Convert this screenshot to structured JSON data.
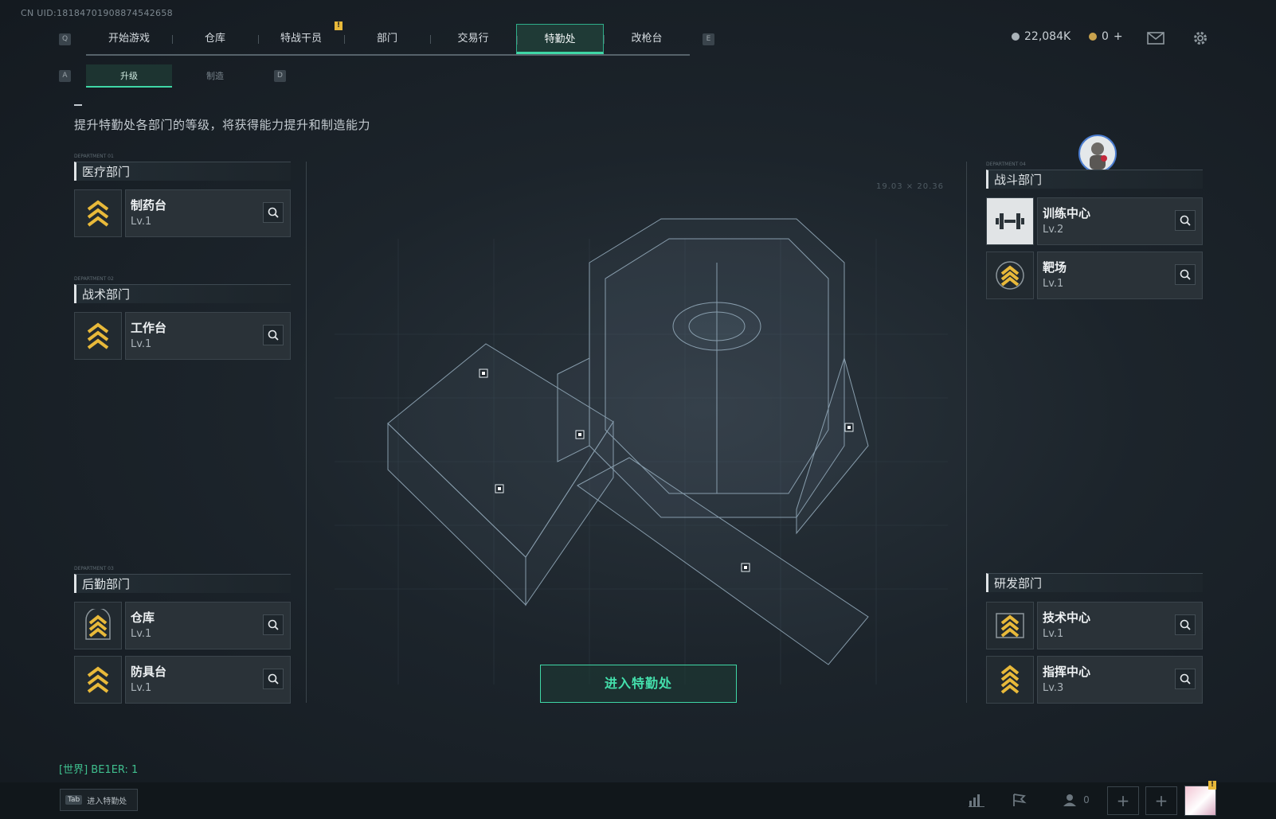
{
  "uid": "CN UID:18184701908874542658",
  "nav": {
    "left_key": "Q",
    "right_key": "E",
    "tabs": [
      {
        "label": "开始游戏"
      },
      {
        "label": "仓库"
      },
      {
        "label": "特战干员"
      },
      {
        "label": "部门"
      },
      {
        "label": "交易行"
      },
      {
        "label": "特勤处",
        "active": true
      },
      {
        "label": "改枪台"
      }
    ],
    "badge": "!"
  },
  "currency": {
    "silver": "22,084K",
    "gold": "0",
    "gold_plus": "+"
  },
  "subtabs": {
    "left_key": "A",
    "right_key": "D",
    "items": [
      {
        "label": "升级",
        "active": true
      },
      {
        "label": "制造"
      }
    ]
  },
  "description": "提升特勤处各部门的等级，将获得能力提升和制造能力",
  "departments": {
    "medical": {
      "tag": "DEPARTMENT 01",
      "title": "医疗部门",
      "items": [
        {
          "name": "制药台",
          "level": "Lv.1"
        }
      ]
    },
    "tactical": {
      "tag": "DEPARTMENT 02",
      "title": "战术部门",
      "items": [
        {
          "name": "工作台",
          "level": "Lv.1"
        }
      ]
    },
    "logistics": {
      "tag": "DEPARTMENT 03",
      "title": "后勤部门",
      "items": [
        {
          "name": "仓库",
          "level": "Lv.1"
        },
        {
          "name": "防具台",
          "level": "Lv.1"
        }
      ]
    },
    "combat": {
      "tag": "DEPARTMENT 04",
      "title": "战斗部门",
      "items": [
        {
          "name": "训练中心",
          "level": "Lv.2"
        },
        {
          "name": "靶场",
          "level": "Lv.1"
        }
      ]
    },
    "research": {
      "title": "研发部门",
      "items": [
        {
          "name": "技术中心",
          "level": "Lv.1"
        },
        {
          "name": "指挥中心",
          "level": "Lv.3"
        }
      ]
    }
  },
  "coords": "19.03 × 20.36",
  "enter_button": "进入特勤处",
  "chat": {
    "channel": "[世界]",
    "text": "BE1ER: 1"
  },
  "bottom": {
    "tab_key": "Tab",
    "tab_label": "进入特勤处",
    "friends_count": "0"
  },
  "icons": {
    "silver_coin": "silver-coin-icon",
    "gold_coin": "gold-coin-icon",
    "mail": "mail-icon",
    "settings": "gear-icon",
    "magnifier": "search-icon",
    "rank": "chevron-rank-icon"
  },
  "colors": {
    "accent": "#3fd7a6",
    "gold": "#e8b93a",
    "panel": "#2a3238"
  }
}
